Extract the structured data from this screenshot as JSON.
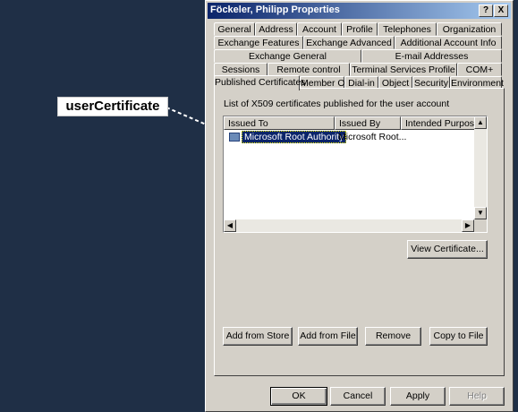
{
  "callout": {
    "label": "userCertificate"
  },
  "window": {
    "title": "Föckeler, Philipp Properties",
    "help_glyph": "?",
    "close_glyph": "X"
  },
  "tabs": {
    "row1": [
      "General",
      "Address",
      "Account",
      "Profile",
      "Telephones",
      "Organization"
    ],
    "row2": [
      "Exchange Features",
      "Exchange Advanced",
      "Additional Account Info"
    ],
    "row3": [
      "Exchange General",
      "E-mail Addresses"
    ],
    "row4": [
      "Sessions",
      "Remote control",
      "Terminal Services Profile",
      "COM+"
    ],
    "row5": [
      "Published Certificates",
      "Member Of",
      "Dial-in",
      "Object",
      "Security",
      "Environment"
    ],
    "active": "Published Certificates"
  },
  "panel": {
    "list_label": "List of X509 certificates published for the user account",
    "columns": [
      "Issued To",
      "Issued By",
      "Intended Purposes"
    ],
    "rows": [
      {
        "issued_to": "Microsoft Root Authority",
        "issued_by": "Microsoft Root..."
      }
    ],
    "view_certificate": "View Certificate...",
    "add_from_store": "Add from Store",
    "add_from_file": "Add from File",
    "remove": "Remove",
    "copy_to_file": "Copy to File"
  },
  "footer": {
    "ok": "OK",
    "cancel": "Cancel",
    "apply": "Apply",
    "help": "Help"
  },
  "colors": {
    "desktop": "#1f2f46",
    "dialog": "#d4d0c8",
    "selection": "#0a246a",
    "title_gradient_start": "#0a246a"
  }
}
